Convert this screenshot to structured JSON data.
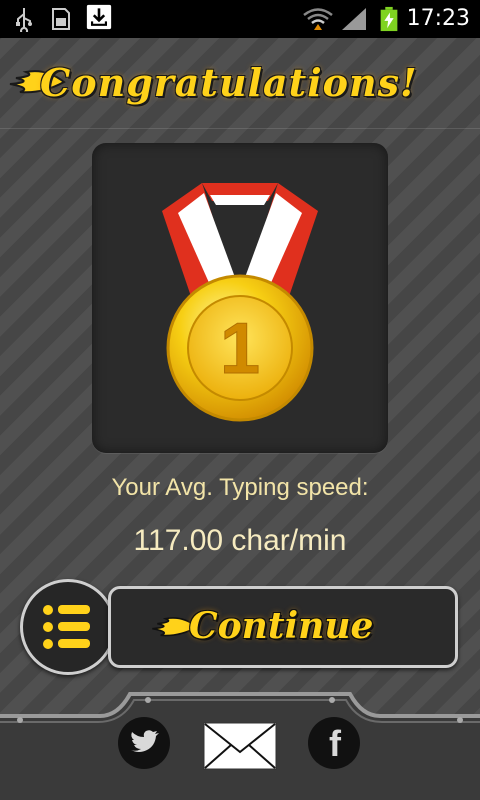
{
  "status_bar": {
    "time": "17:23",
    "icons": [
      "usb-icon",
      "sd-card-icon",
      "download-icon",
      "wifi-icon",
      "signal-icon",
      "battery-charging-icon"
    ]
  },
  "header": {
    "title": "Congratulations!"
  },
  "result": {
    "medal_number": "1",
    "label": "Your Avg. Typing speed:",
    "speed": "117.00 char/min"
  },
  "actions": {
    "continue_label": "Continue",
    "menu_icon": "list-menu-icon"
  },
  "social": {
    "icons": [
      "twitter-icon",
      "email-icon",
      "facebook-icon"
    ],
    "facebook_glyph": "f"
  },
  "colors": {
    "title_yellow": "#ffd21a",
    "background": "#4a4a4a",
    "card": "#2b2b2b",
    "ribbon_red": "#e0301e",
    "medal_gold": "#f5c400"
  }
}
